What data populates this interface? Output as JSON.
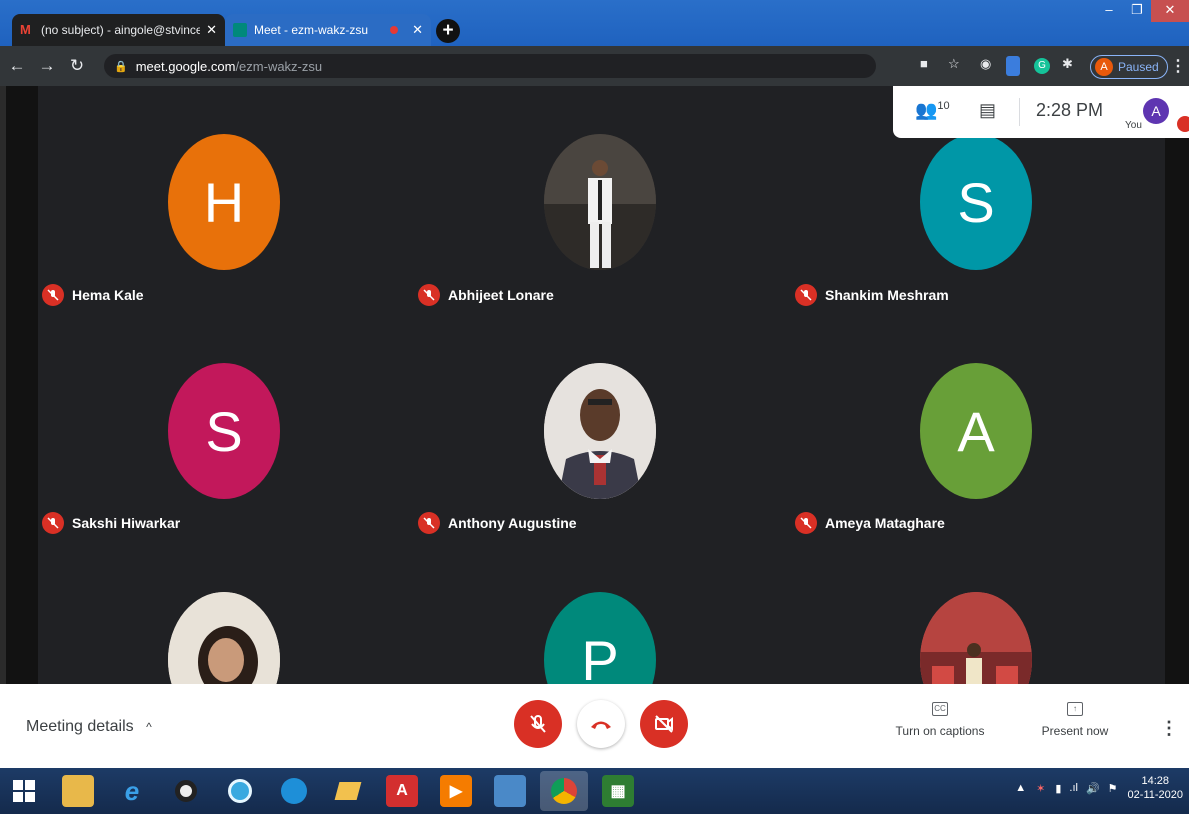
{
  "browser": {
    "tabs": [
      {
        "title": "(no subject) - aingole@stvincent",
        "icon": "gmail-icon",
        "color": "#ea4335"
      },
      {
        "title": "Meet - ezm-wakz-zsu",
        "icon": "meet-icon",
        "color": "#00897b"
      }
    ],
    "url_host": "meet.google.com",
    "url_path": "/ezm-wakz-zsu",
    "profile_initial": "A",
    "profile_status": "Paused"
  },
  "meet": {
    "participant_count": "10",
    "time": "2:28 PM",
    "self_label": "You",
    "self_initial": "A",
    "participants": [
      {
        "name": "Hema Kale",
        "initial": "H",
        "color": "#e8710a"
      },
      {
        "name": "Abhijeet Lonare",
        "initial": "",
        "color": "#3a3a3a"
      },
      {
        "name": "Shankim Meshram",
        "initial": "S",
        "color": "#0097a7"
      },
      {
        "name": "Sakshi Hiwarkar",
        "initial": "S",
        "color": "#c2185b"
      },
      {
        "name": "Anthony Augustine",
        "initial": "",
        "color": "#d7d2cc"
      },
      {
        "name": "Ameya Mataghare",
        "initial": "A",
        "color": "#689f38"
      },
      {
        "name": "",
        "initial": "",
        "color": "#d8d0c4"
      },
      {
        "name": "",
        "initial": "P",
        "color": "#00897b"
      },
      {
        "name": "",
        "initial": "",
        "color": "#c0504d"
      }
    ],
    "meeting_details": "Meeting details",
    "captions_label": "Turn on captions",
    "captions_icon": "CC",
    "present_label": "Present now"
  },
  "taskbar": {
    "time": "14:28",
    "date": "02-11-2020"
  }
}
